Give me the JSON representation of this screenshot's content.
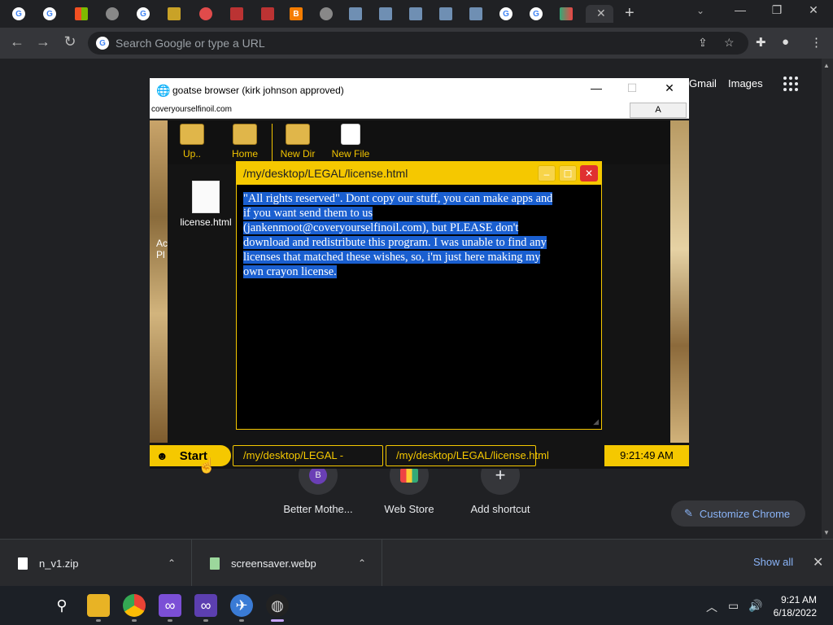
{
  "chrome": {
    "search_placeholder": "Search Google or type a URL",
    "top_links": {
      "gmail": "Gmail",
      "images": "Images"
    },
    "shortcuts": [
      {
        "label": "Better Mothe...",
        "badge": "B"
      },
      {
        "label": "Web Store",
        "badge": ""
      },
      {
        "label": "Add shortcut",
        "badge": "+"
      }
    ],
    "customize_label": "Customize Chrome"
  },
  "gwin": {
    "title": "goatse browser (kirk johnson approved)",
    "url": "coveryourselfinoil.com",
    "a_button": "A",
    "toolbar": [
      "Up..",
      "Home",
      "New Dir",
      "New File"
    ],
    "desktop_file": "license.html",
    "left_cut_text": "Ac\nPl"
  },
  "inner": {
    "title": "/my/desktop/LEGAL/license.html",
    "content_lines": [
      "\"All rights reserved\". Dont copy our stuff, you can make apps and",
      "if you want send them to us",
      "(jankenmoot@coveryourselfinoil.com), but PLEASE don't",
      "download and redistribute this program. I was unable to find any",
      "licenses that matched these wishes, so, i'm just here making my",
      "own crayon license."
    ]
  },
  "gtask": {
    "start": "Start",
    "items": [
      "/my/desktop/LEGAL -",
      "/my/desktop/LEGAL/license.html"
    ],
    "clock": "9:21:49 AM"
  },
  "downloads": {
    "items": [
      "n_v1.zip",
      "screensaver.webp"
    ],
    "show_all": "Show all"
  },
  "taskbar": {
    "time": "9:21 AM",
    "date": "6/18/2022"
  }
}
